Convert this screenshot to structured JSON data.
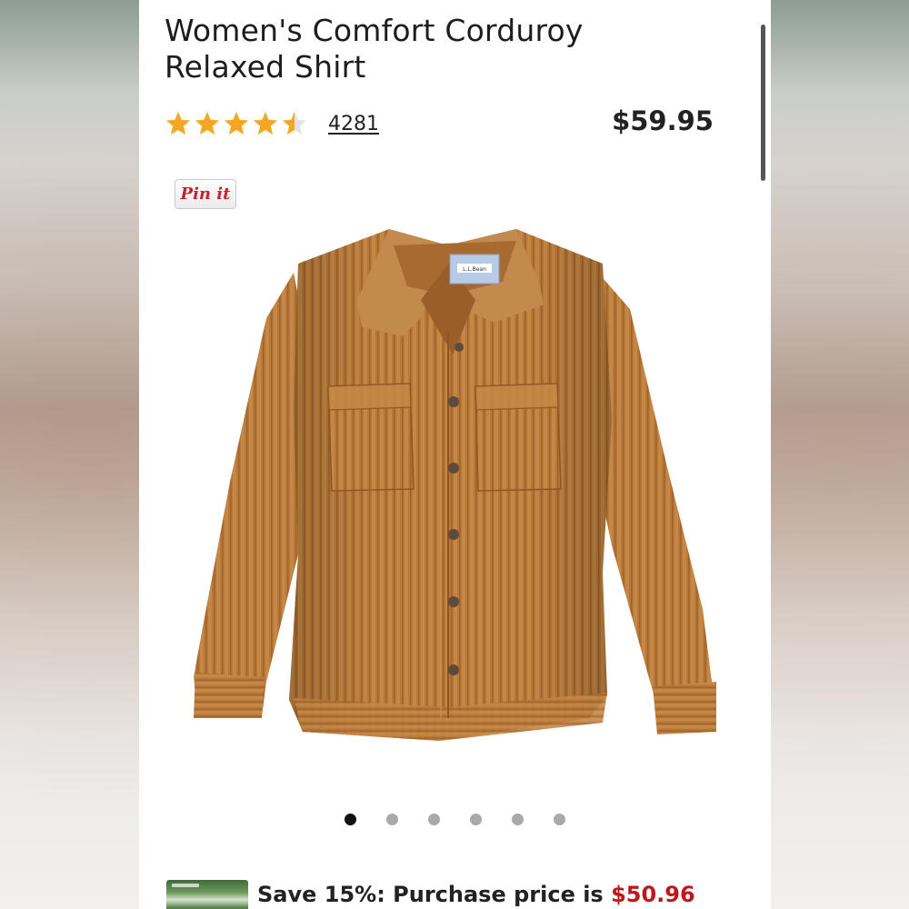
{
  "product": {
    "title": "Women's Comfort Corduroy Relaxed Shirt",
    "rating": 4.5,
    "rating_max": 5,
    "review_count": "4281",
    "price": "$59.95",
    "star_color": "#f5a623"
  },
  "pin_button": {
    "label": "Pin it"
  },
  "gallery": {
    "image_count": 6,
    "active_index": 0,
    "shirt_label": "L.L.Bean"
  },
  "promo": {
    "text": "Save 15%: Purchase price is ",
    "price": "$50.96",
    "price_color": "#c0171c"
  }
}
